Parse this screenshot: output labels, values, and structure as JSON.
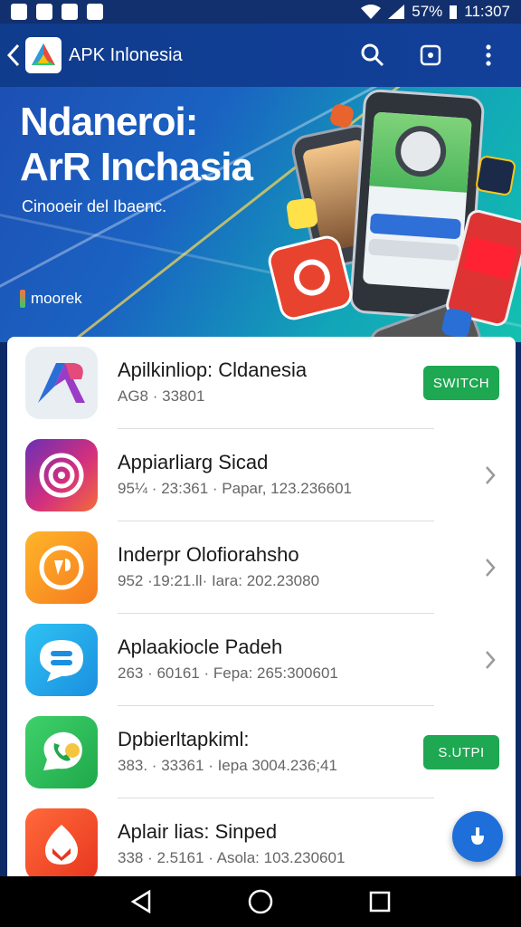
{
  "status_bar": {
    "battery": "57%",
    "time": "11:307"
  },
  "app_bar": {
    "title": "APK Inlonesia"
  },
  "banner": {
    "title_line1": "Ndaneroi:",
    "title_line2": "ArR Inchasia",
    "subtitle": "Cinooeir del Ibaenc.",
    "brand": "moorek"
  },
  "apps": [
    {
      "title": "Apilkinliop: Cldanesia",
      "meta": "AG8 · 33801",
      "action": "SWITCH",
      "action_type": "button"
    },
    {
      "title": "Appiarliarg Sicad",
      "meta": "95¼ · 23:361 · Papar, 123.236601",
      "action_type": "chevron"
    },
    {
      "title": "Inderpr Olofiorahsho",
      "meta": "952 ·19:21.ll· Iara: 202.23080",
      "action_type": "chevron"
    },
    {
      "title": "Aplaakiocle Padeh",
      "meta": "263 · 60161 · Fepa: 265:300601",
      "action_type": "chevron"
    },
    {
      "title": "Dpbierltapkiml:",
      "meta": "383. · 33361 · Iepa 3004.236;41",
      "action": "S.UTPI",
      "action_type": "button"
    },
    {
      "title": "Aplair lias: Sinped",
      "meta": "338 · 2.5161 · Asola: 103.230601",
      "action_type": "none"
    }
  ],
  "colors": {
    "accent": "#1da851",
    "app_bar": "#0f3c8c",
    "fab": "#1e6fd9"
  }
}
